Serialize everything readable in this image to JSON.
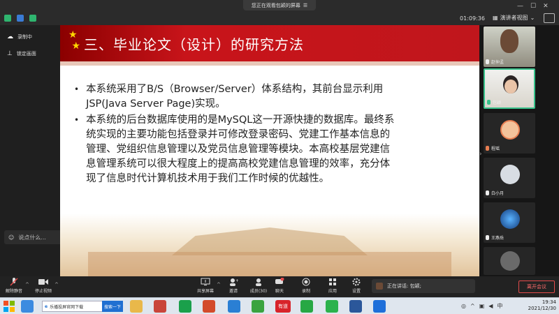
{
  "topbar": {
    "share_banner": "您正在观看包颖的屏幕",
    "timer": "01:09:36",
    "speaker_view": "演讲者视图"
  },
  "left_panel": {
    "recording": "录制中",
    "lock_screen": "锁定画面",
    "chat_placeholder": "说点什么..."
  },
  "slide": {
    "title": "三、毕业论文（设计）的研究方法",
    "bullets": [
      "本系统采用了B/S（Browser/Server）体系结构，其前台显示利用JSP(Java Server Page)实现。",
      "本系统的后台数据库使用的是MySQL这一开源快捷的数据库。最终系统实现的主要功能包括登录并可修改登录密码、党建工作基本信息的管理、党组织信息管理以及党员信息管理等模块。本高校基层党建信息管理系统可以很大程度上的提高高校党建信息管理的效率，充分体现了信息时代计算机技术用于我们工作时候的优越性。"
    ]
  },
  "participants": [
    {
      "name": "赵仲孟"
    },
    {
      "name": "包颖"
    },
    {
      "name": "程瑶"
    },
    {
      "name": "白小月"
    },
    {
      "name": "王燕岳"
    }
  ],
  "toolbar": {
    "mute": "解除静音",
    "video": "停止视频",
    "share": "共享屏幕",
    "invite": "邀请",
    "members": "成员(30)",
    "chat": "聊天",
    "chat_badge": "2",
    "record": "录制",
    "apps": "应用",
    "settings": "设置",
    "speaking": "正在讲话: 包颖;",
    "leave": "离开会议"
  },
  "taskbar": {
    "browser_tab": "乐播投屏官网下载",
    "search_go": "搜索一下",
    "youdao": "有道",
    "ime": "中",
    "time": "19:34",
    "date": "2021/12/30"
  }
}
